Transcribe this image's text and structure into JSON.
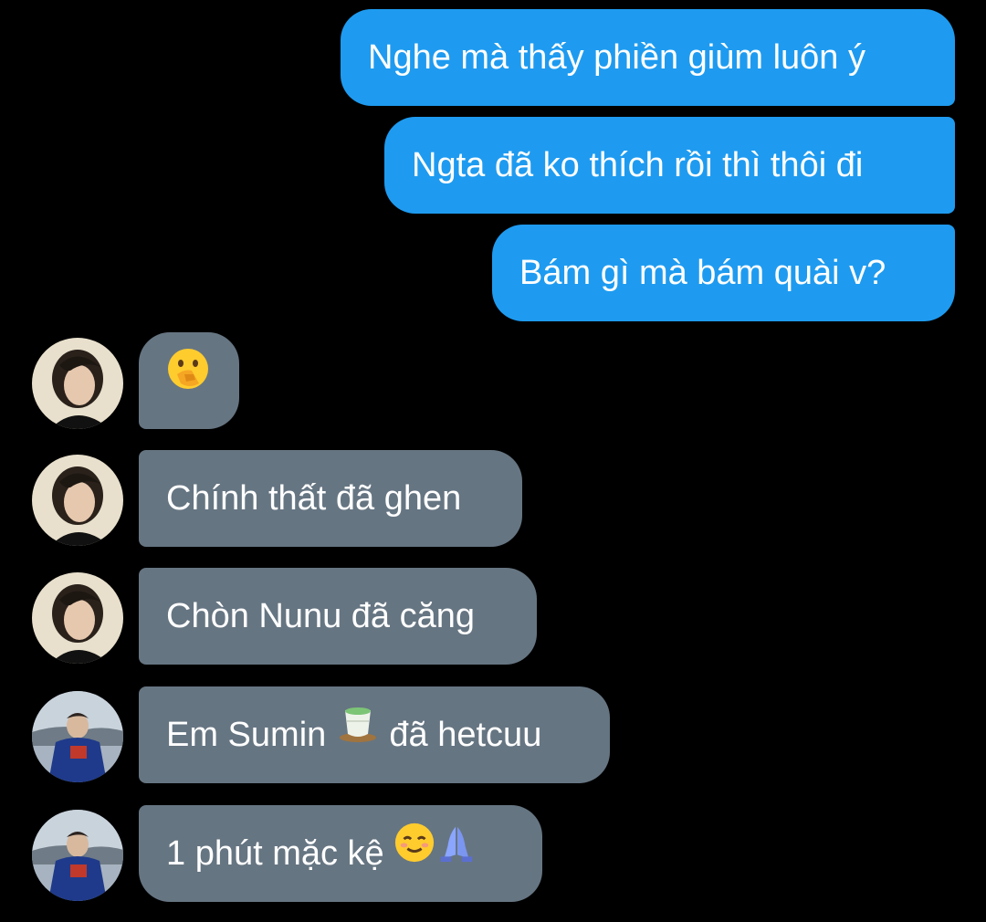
{
  "messages": {
    "sent": [
      "Nghe mà thấy phiền giùm luôn ý",
      "Ngta đã ko thích rồi thì thôi đi",
      "Bám gì mà bám quài v?"
    ],
    "received": {
      "emoji_only": {
        "emoji": "shushing-face-icon"
      },
      "m2": "Chính thất đã ghen",
      "m3": "Chòn Nunu đã căng",
      "m4_before": "Em Sumin",
      "m4_emoji": "teacup-icon",
      "m4_after": "đã hetcuu",
      "m5": "1 phút mặc kệ",
      "m5_emojis": [
        "relieved-face-icon",
        "folded-hands-icon"
      ]
    }
  },
  "avatars": [
    "avatar-user-curly-hair",
    "avatar-user-curly-hair",
    "avatar-user-curly-hair",
    "avatar-user-blue-sweater",
    "avatar-user-blue-sweater"
  ],
  "colors": {
    "background": "#000000",
    "sent_bubble": "#1e9bf0",
    "received_bubble": "#667582",
    "text": "#ffffff"
  }
}
